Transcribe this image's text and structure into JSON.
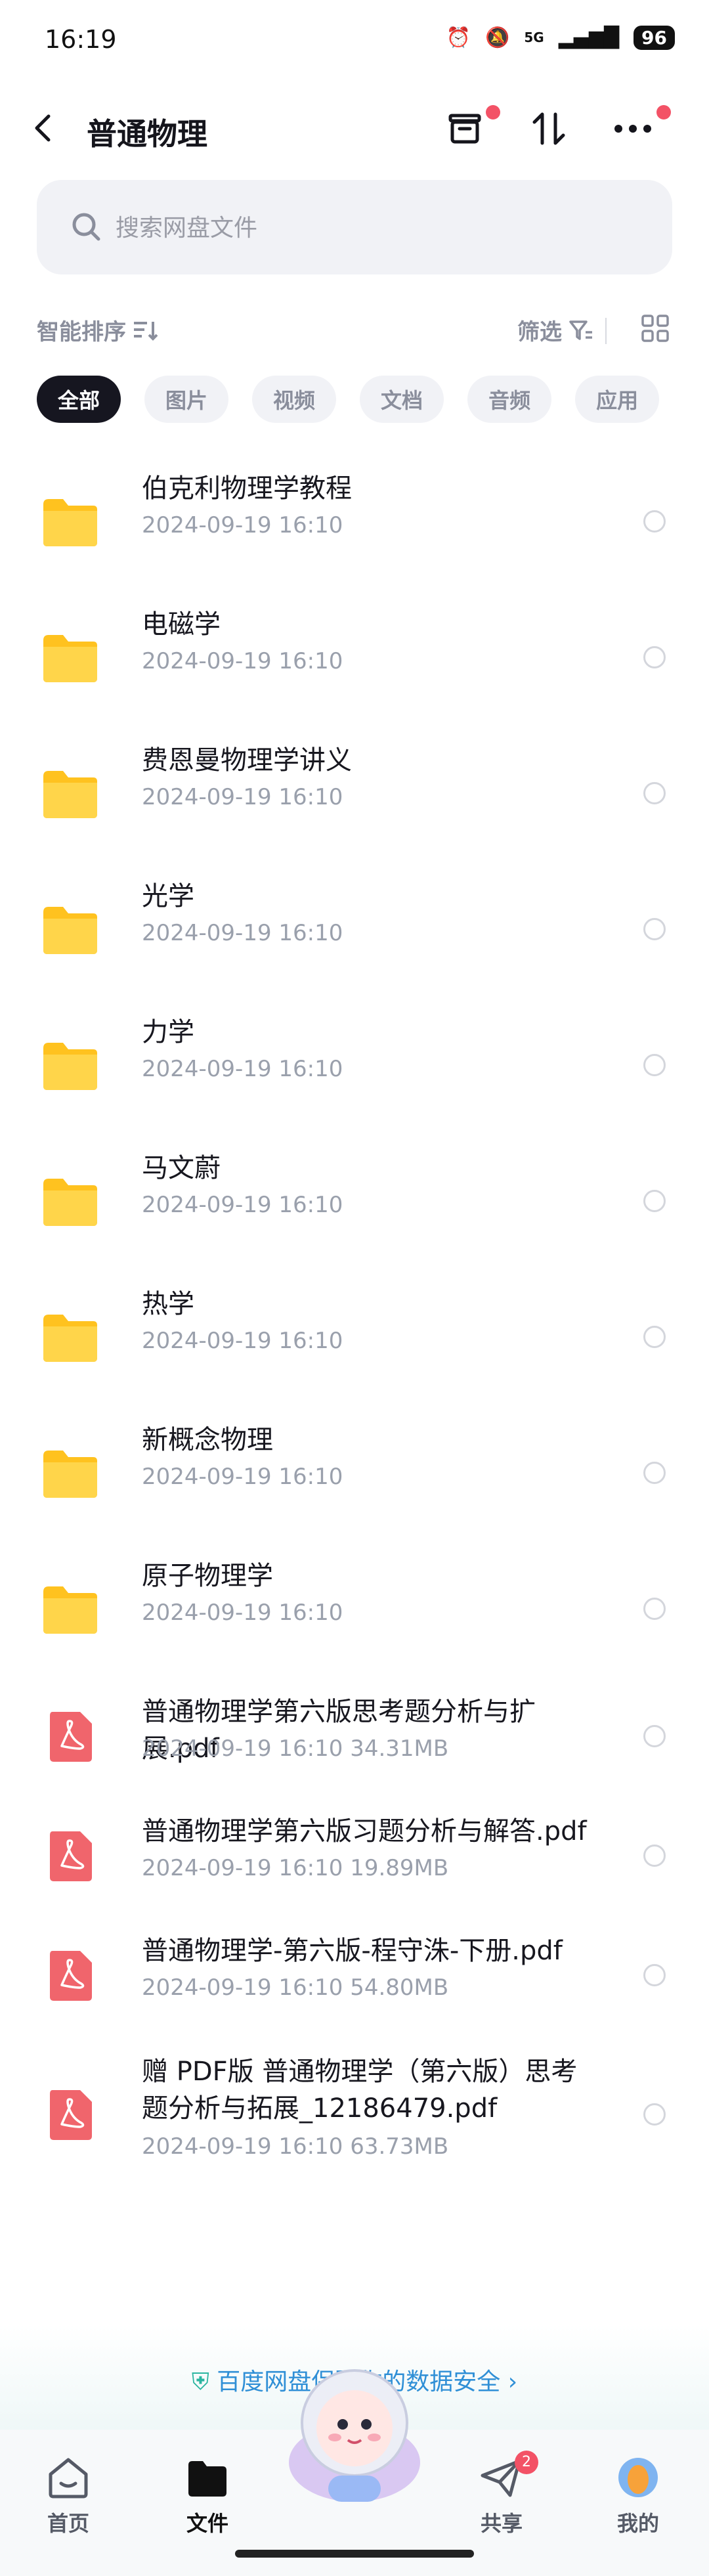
{
  "status": {
    "time": "16:19",
    "battery": "96",
    "network": "5G"
  },
  "header": {
    "title": "普通物理"
  },
  "search": {
    "placeholder": "搜索网盘文件"
  },
  "toolbar": {
    "sort_label": "智能排序",
    "filter_label": "筛选"
  },
  "chips": [
    "全部",
    "图片",
    "视频",
    "文档",
    "音频",
    "应用"
  ],
  "files": [
    {
      "name": "伯克利物理学教程",
      "meta": "2024-09-19  16:10",
      "type": "folder"
    },
    {
      "name": "电磁学",
      "meta": "2024-09-19  16:10",
      "type": "folder"
    },
    {
      "name": "费恩曼物理学讲义",
      "meta": "2024-09-19  16:10",
      "type": "folder"
    },
    {
      "name": "光学",
      "meta": "2024-09-19  16:10",
      "type": "folder"
    },
    {
      "name": "力学",
      "meta": "2024-09-19  16:10",
      "type": "folder"
    },
    {
      "name": "马文蔚",
      "meta": "2024-09-19  16:10",
      "type": "folder"
    },
    {
      "name": "热学",
      "meta": "2024-09-19  16:10",
      "type": "folder"
    },
    {
      "name": "新概念物理",
      "meta": "2024-09-19  16:10",
      "type": "folder"
    },
    {
      "name": "原子物理学",
      "meta": "2024-09-19  16:10",
      "type": "folder"
    },
    {
      "name": "普通物理学第六版思考题分析与扩展.pdf",
      "meta": "2024-09-19  16:10  34.31MB",
      "type": "pdf"
    },
    {
      "name": "普通物理学第六版习题分析与解答.pdf",
      "meta": "2024-09-19  16:10  19.89MB",
      "type": "pdf"
    },
    {
      "name": "普通物理学-第六版-程守洙-下册.pdf",
      "meta": "2024-09-19  16:10  54.80MB",
      "type": "pdf"
    },
    {
      "name": "赠 PDF版 普通物理学（第六版）思考题分析与拓展_12186479.pdf",
      "meta": "2024-09-19  16:10  63.73MB",
      "type": "pdf"
    }
  ],
  "banner": {
    "text": "百度网盘保障你的数据安全"
  },
  "tabs": [
    {
      "label": "首页"
    },
    {
      "label": "文件"
    },
    {
      "label": "共享",
      "badge": "2"
    },
    {
      "label": "我的"
    }
  ],
  "colors": {
    "folder": "#ffcb2f",
    "pdf": "#f0656c",
    "accent": "#161620",
    "badge": "#f35266"
  }
}
